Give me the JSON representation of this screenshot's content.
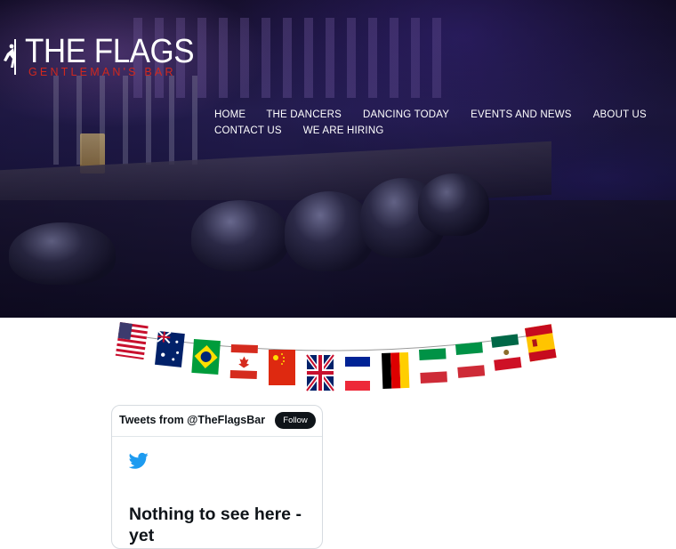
{
  "brand": {
    "title": "THE FLAGS",
    "subtitle": "GENTLEMAN'S BAR",
    "subtitle_color": "#d0281f"
  },
  "nav": {
    "items": [
      {
        "label": "HOME"
      },
      {
        "label": "THE DANCERS"
      },
      {
        "label": "DANCING TODAY"
      },
      {
        "label": "EVENTS AND NEWS"
      },
      {
        "label": "ABOUT US"
      },
      {
        "label": "CONTACT US"
      },
      {
        "label": "WE ARE HIRING"
      }
    ]
  },
  "bunting": {
    "flags": [
      "united-states-flag",
      "australia-flag",
      "brazil-flag",
      "canada-flag",
      "china-flag",
      "united-kingdom-flag",
      "france-flag",
      "germany-flag",
      "italy-flag",
      "italy-flag",
      "mexico-flag",
      "spain-flag"
    ]
  },
  "twitter": {
    "title": "Tweets from @TheFlagsBar",
    "follow_label": "Follow",
    "empty_text": "Nothing to see here - yet",
    "bird_icon": "twitter-bird-icon",
    "bird_color": "#1d9bf0"
  }
}
